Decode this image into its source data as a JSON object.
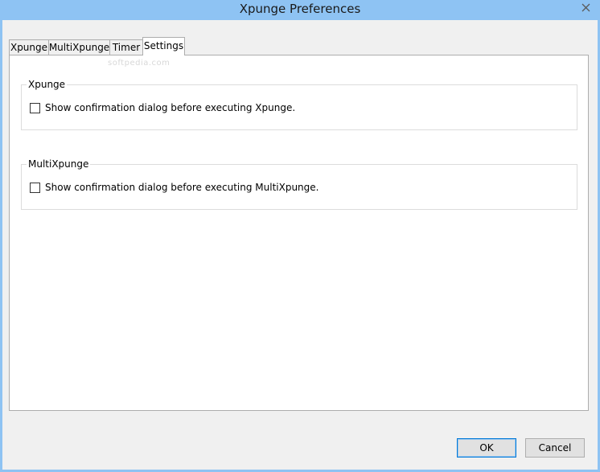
{
  "window": {
    "title": "Xpunge Preferences"
  },
  "tabs": [
    {
      "label": "Xpunge"
    },
    {
      "label": "MultiXpunge"
    },
    {
      "label": "Timer"
    },
    {
      "label": "Settings"
    }
  ],
  "watermark": "softpedia.com",
  "groups": [
    {
      "title": "Xpunge",
      "checkbox_label": "Show confirmation dialog before executing Xpunge.",
      "checked": false
    },
    {
      "title": "MultiXpunge",
      "checkbox_label": "Show confirmation dialog before executing MultiXpunge.",
      "checked": false
    }
  ],
  "buttons": {
    "ok_label": "OK",
    "cancel_label": "Cancel"
  },
  "icons": {
    "close": "close-icon"
  },
  "colors": {
    "titlebar": "#8ec3f3",
    "client": "#f0f0f0",
    "panel": "#ffffff",
    "default_button_border": "#0078d7"
  }
}
